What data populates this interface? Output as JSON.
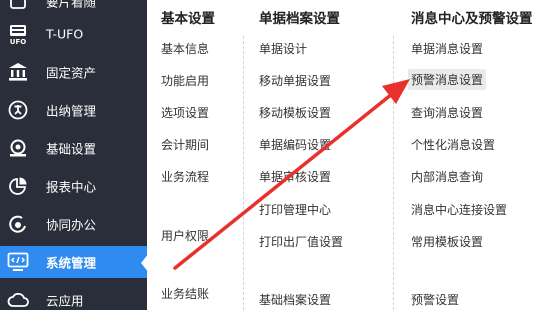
{
  "sidebar": {
    "items": [
      {
        "label": "要片看随",
        "icon": "dashboard-icon"
      },
      {
        "label": "T-UFO",
        "icon": "ufo-icon"
      },
      {
        "label": "固定资产",
        "icon": "bank-icon"
      },
      {
        "label": "出纳管理",
        "icon": "cashier-icon"
      },
      {
        "label": "基础设置",
        "icon": "settings-icon"
      },
      {
        "label": "报表中心",
        "icon": "pie-chart-icon"
      },
      {
        "label": "协同办公",
        "icon": "collaboration-icon"
      },
      {
        "label": "系统管理",
        "icon": "system-monitor-icon",
        "active": true
      },
      {
        "label": "云应用",
        "icon": "cloud-icon"
      }
    ],
    "active_color": "#2f8bf0",
    "background_color": "#2a2e3b"
  },
  "menu": {
    "columns": [
      {
        "title": "基本设置",
        "items": [
          "基本信息",
          "功能启用",
          "选项设置",
          "会计期间",
          "业务流程",
          "用户权限",
          "业务结账"
        ]
      },
      {
        "title": "单据档案设置",
        "items": [
          "单据设计",
          "移动单据设置",
          "移动模板设置",
          "单据编码设置",
          "单据审核设置",
          "打印管理中心",
          "打印出厂值设置",
          "基础档案设置"
        ]
      },
      {
        "title": "消息中心及预警设置",
        "items": [
          "单据消息设置",
          "预警消息设置",
          "查询消息设置",
          "个性化消息设置",
          "内部消息查询",
          "消息中心连接设置",
          "常用模板设置",
          "预警设置"
        ],
        "highlighted": "预警消息设置"
      }
    ]
  },
  "annotation": {
    "arrow_color": "#e8312c",
    "arrow": "red-arrow"
  }
}
